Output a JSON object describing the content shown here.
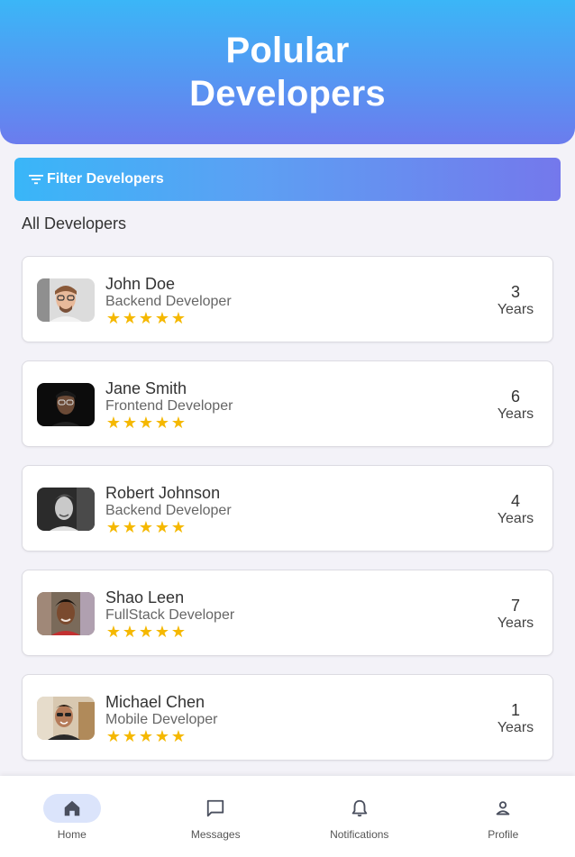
{
  "header": {
    "title_line1": "Polular",
    "title_line2": "Developers"
  },
  "filter": {
    "label": "Filter Developers",
    "icon": "filter-list-icon"
  },
  "section": {
    "title": "All Developers"
  },
  "developers": [
    {
      "name": "John Doe",
      "role": "Backend Developer",
      "rating": 5,
      "years": "3",
      "years_unit": "Years"
    },
    {
      "name": "Jane Smith",
      "role": "Frontend Developer",
      "rating": 5,
      "years": "6",
      "years_unit": "Years"
    },
    {
      "name": "Robert Johnson",
      "role": "Backend Developer",
      "rating": 5,
      "years": "4",
      "years_unit": "Years"
    },
    {
      "name": "Shao Leen",
      "role": "FullStack Developer",
      "rating": 5,
      "years": "7",
      "years_unit": "Years"
    },
    {
      "name": "Michael Chen",
      "role": "Mobile Developer",
      "rating": 5,
      "years": "1",
      "years_unit": "Years"
    }
  ],
  "nav": [
    {
      "label": "Home",
      "icon": "home-icon",
      "active": true
    },
    {
      "label": "Messages",
      "icon": "message-icon",
      "active": false
    },
    {
      "label": "Notifications",
      "icon": "bell-icon",
      "active": false
    },
    {
      "label": "Profile",
      "icon": "person-icon",
      "active": false
    }
  ],
  "colors": {
    "star": "#f5b800",
    "header_top": "#3bb6f7",
    "header_bottom": "#6b7cee"
  }
}
